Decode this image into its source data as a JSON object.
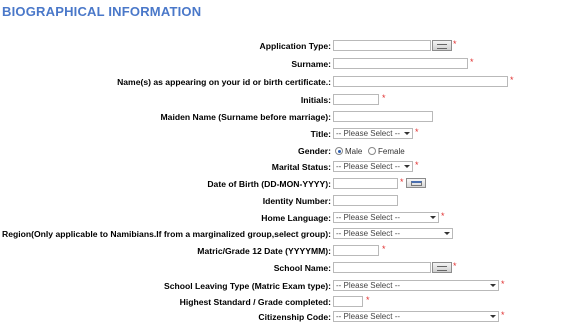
{
  "section_title": "BIOGRAPHICAL INFORMATION",
  "fields": {
    "application_type": {
      "label": "Application Type:",
      "value": ""
    },
    "surname": {
      "label": "Surname:",
      "value": ""
    },
    "names": {
      "label": "Name(s) as appearing on your id or birth certificate.:",
      "value": ""
    },
    "initials": {
      "label": "Initials:",
      "value": ""
    },
    "maiden_name": {
      "label": "Maiden Name (Surname before marriage):",
      "value": ""
    },
    "title": {
      "label": "Title:",
      "selected": "-- Please Select --"
    },
    "gender": {
      "label": "Gender:",
      "options": [
        "Male",
        "Female"
      ],
      "selected": "Male"
    },
    "marital_status": {
      "label": "Marital Status:",
      "selected": "-- Please Select --"
    },
    "date_of_birth": {
      "label": "Date of Birth (DD-MON-YYYY):",
      "value": ""
    },
    "identity_number": {
      "label": "Identity Number:",
      "value": ""
    },
    "home_language": {
      "label": "Home Language:",
      "selected": "-- Please Select --"
    },
    "region": {
      "label": "Region(Only applicable to Namibians.If from a marginalized group,select group):",
      "selected": "-- Please Select --"
    },
    "matric_date": {
      "label": "Matric/Grade 12 Date (YYYYMM):",
      "value": ""
    },
    "school_name": {
      "label": "School Name:",
      "value": ""
    },
    "school_leaving_type": {
      "label": "School Leaving Type (Matric Exam type):",
      "selected": "-- Please Select --"
    },
    "highest_standard": {
      "label": "Highest Standard / Grade completed:",
      "value": ""
    },
    "citizenship_code": {
      "label": "Citizenship Code:",
      "selected": "-- Please Select --"
    }
  },
  "required_marker": "*",
  "icons": {
    "lookup": "lookup-button-icon",
    "calendar": "calendar-icon",
    "dropdown": "dropdown-caret-icon"
  }
}
